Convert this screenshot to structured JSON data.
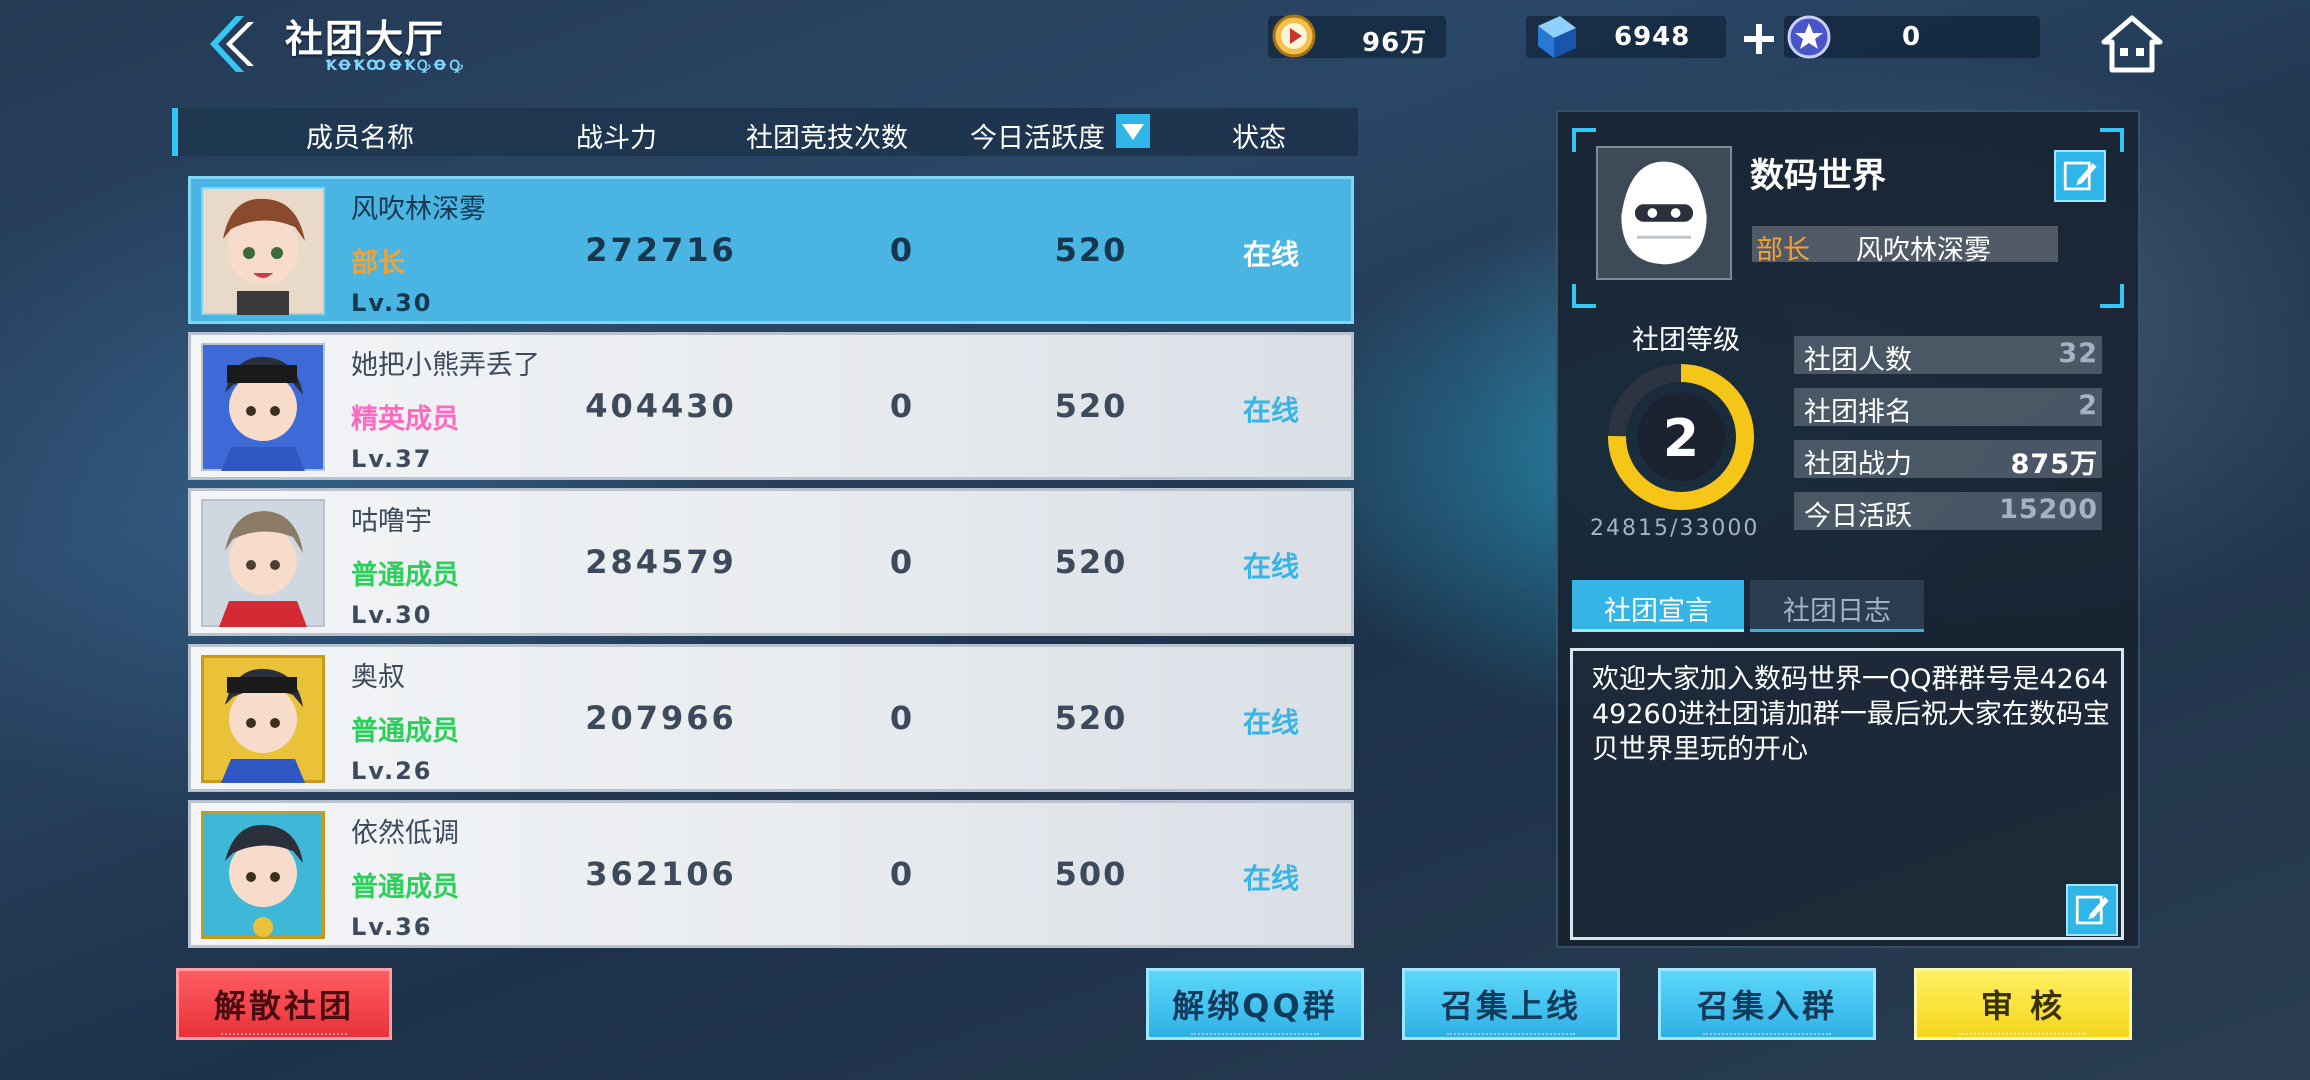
{
  "header": {
    "title": "社团大厅",
    "subtitle": "ꝀꝊꝀꝎꝊꝀꝘꝊꝘ"
  },
  "resources": {
    "coin": "96万",
    "gems": "6948",
    "stars": "0"
  },
  "table": {
    "columns": [
      "成员名称",
      "战斗力",
      "社团竞技次数",
      "今日活跃度",
      "状态"
    ],
    "rows": [
      {
        "name": "风吹林深雾",
        "role": "部长",
        "role_color": "#f2a235",
        "level": "Lv.30",
        "power": "272716",
        "competitions": "0",
        "activity": "520",
        "status": "在线",
        "selected": true
      },
      {
        "name": "她把小熊弄丢了",
        "role": "精英成员",
        "role_color": "#ff6ac0",
        "level": "Lv.37",
        "power": "404430",
        "competitions": "0",
        "activity": "520",
        "status": "在线",
        "selected": false
      },
      {
        "name": "咕噜宇",
        "role": "普通成员",
        "role_color": "#2bcf5a",
        "level": "Lv.30",
        "power": "284579",
        "competitions": "0",
        "activity": "520",
        "status": "在线",
        "selected": false
      },
      {
        "name": "奥叔",
        "role": "普通成员",
        "role_color": "#2bcf5a",
        "level": "Lv.26",
        "power": "207966",
        "competitions": "0",
        "activity": "520",
        "status": "在线",
        "selected": false
      },
      {
        "name": "依然低调",
        "role": "普通成员",
        "role_color": "#2bcf5a",
        "level": "Lv.36",
        "power": "362106",
        "competitions": "0",
        "activity": "500",
        "status": "在线",
        "selected": false
      }
    ]
  },
  "club": {
    "name": "数码世界",
    "leader_label": "部长",
    "leader_name": "风吹林深雾",
    "level_label": "社团等级",
    "level": "2",
    "exp": "24815/33000",
    "exp_progress": 0.752,
    "stats": [
      {
        "label": "社团人数",
        "value": "32"
      },
      {
        "label": "社团排名",
        "value": "2"
      },
      {
        "label": "社团战力",
        "value": "875万"
      },
      {
        "label": "今日活跃",
        "value": "15200"
      }
    ],
    "tabs": [
      "社团宣言",
      "社团日志"
    ],
    "announcement": "欢迎大家加入数码世界一QQ群群号是426449260进社团请加群一最后祝大家在数码宝贝世界里玩的开心"
  },
  "buttons": {
    "disband": "解散社团",
    "unbind_qq": "解绑QQ群",
    "summon_online": "召集上线",
    "summon_group": "召集入群",
    "review": "审 核"
  },
  "colors": {
    "accent": "#35c7f4",
    "selected_row": "#4ab5e3",
    "online": "#36b6e6",
    "ring": "#f5c518"
  },
  "icons": [
    "back-arrow-icon",
    "coin-icon",
    "gem-cube-icon",
    "plus-icon",
    "star-badge-icon",
    "home-icon",
    "sort-down-icon",
    "club-egg-icon",
    "edit-icon"
  ]
}
